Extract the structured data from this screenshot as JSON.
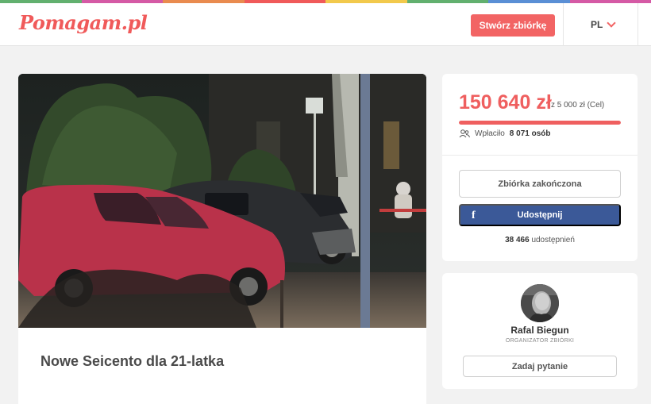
{
  "colors": {
    "accent": "#f26464",
    "facebook": "#3b5998",
    "stripe": [
      "#62b06f",
      "#d55aa5",
      "#e98b4f",
      "#f05a5a",
      "#f2c94c",
      "#62b06f",
      "#5a8fd5",
      "#d55aa5"
    ]
  },
  "header": {
    "logo": "Pomagam.pl",
    "create_button": "Stwórz zbiórkę",
    "language": "PL"
  },
  "campaign": {
    "title": "Nowe Seicento dla 21-latka",
    "photo": "car-crash-photo"
  },
  "stats": {
    "raised": "150 640 zł",
    "goal": "z 5 000 zł (Cel)",
    "progress_percent": 100,
    "paid_prefix": "Wpłaciło",
    "paid_count": "8 071 osób",
    "ended_button": "Zbiórka zakończona",
    "share_button": "Udostępnij",
    "share_count": "38 466",
    "share_suffix": "udostępnień",
    "icons": {
      "people": "people-icon",
      "facebook": "facebook-icon"
    }
  },
  "organizer": {
    "name": "Rafal Biegun",
    "role": "ORGANIZATOR ZBIÓRKI",
    "ask_button": "Zadaj pytanie"
  }
}
